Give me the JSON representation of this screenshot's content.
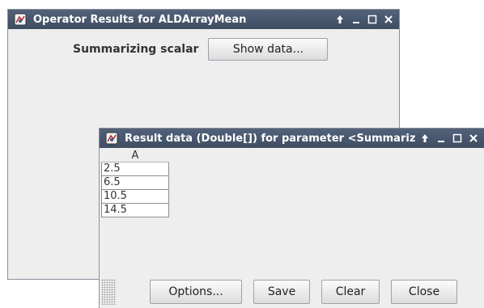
{
  "window_main": {
    "title": "Operator Results for ALDArrayMean",
    "label": "Summarizing scalar",
    "show_button": "Show data..."
  },
  "window_data": {
    "title": "Result data (Double[]) for parameter <Summarizing sca",
    "column_header": "A",
    "rows": [
      "2.5",
      "6.5",
      "10.5",
      "14.5"
    ],
    "buttons": {
      "options": "Options...",
      "save": "Save",
      "clear": "Clear",
      "close": "Close"
    }
  },
  "icons": [
    "app-icon",
    "pin-icon",
    "minimize-icon",
    "maximize-icon",
    "close-icon",
    "resize-grip-icon"
  ],
  "colors": {
    "titlebar": "#485870",
    "window_bg": "#eeeeee"
  }
}
